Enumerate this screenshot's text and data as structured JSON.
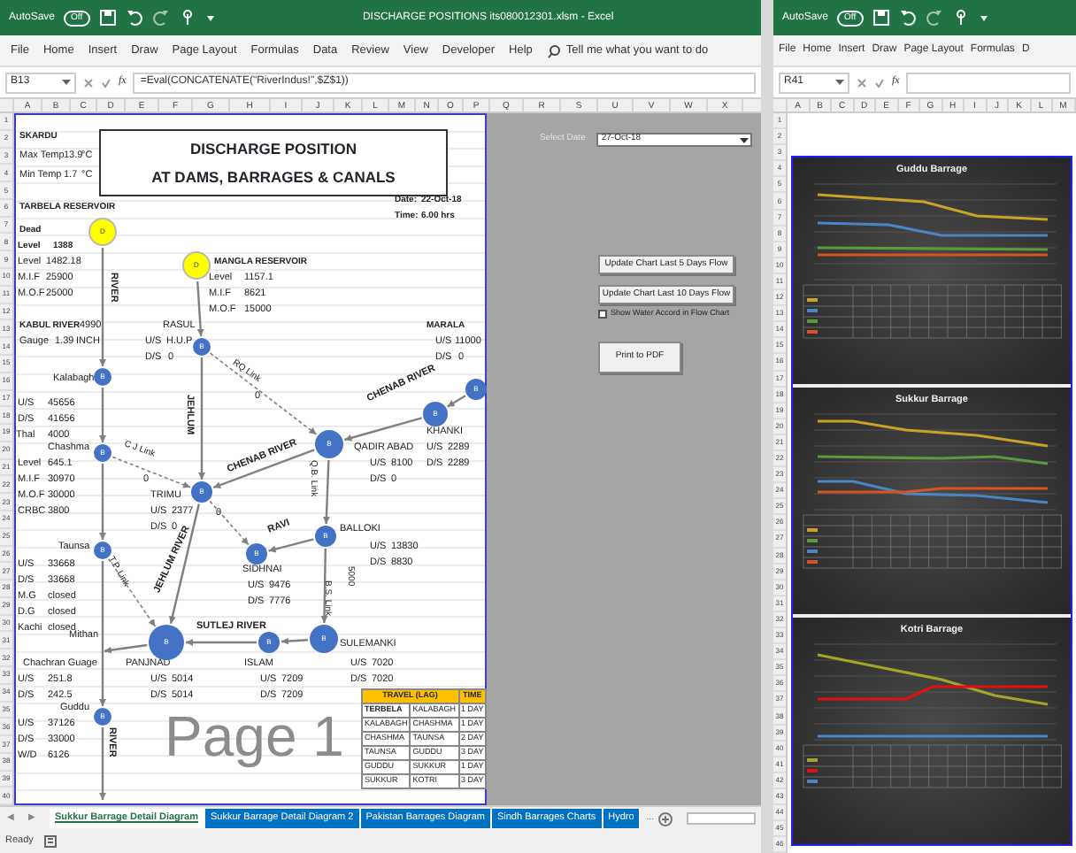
{
  "main_window": {
    "title_bar": {
      "autosave_label": "AutoSave",
      "autosave": {
        "on": false,
        "text": "Off"
      },
      "title": "DISCHARGE POSITIONS its080012301.xlsm - Excel"
    },
    "ribbon_tabs": [
      "File",
      "Home",
      "Insert",
      "Draw",
      "Page Layout",
      "Formulas",
      "Data",
      "Review",
      "View",
      "Developer",
      "Help"
    ],
    "search_hint": "Tell me what you want to do",
    "name_box": "B13",
    "fx": "fx",
    "formula": "=Eval(CONCATENATE(\"RiverIndus!\",$Z$1))",
    "columns": [
      "A",
      "B",
      "C",
      "D",
      "E",
      "F",
      "G",
      "H",
      "I",
      "J",
      "K",
      "L",
      "M",
      "N",
      "O",
      "P",
      "Q",
      "R",
      "S",
      "U",
      "V",
      "W",
      "X"
    ],
    "rows": [
      "1",
      "2",
      "3",
      "4",
      "5",
      "6",
      "7",
      "8",
      "9",
      "10",
      "11",
      "12",
      "13",
      "14",
      "15",
      "16",
      "17",
      "18",
      "19",
      "20",
      "21",
      "22",
      "23",
      "24",
      "25",
      "26",
      "27",
      "28",
      "29",
      "30",
      "31",
      "32",
      "33",
      "34",
      "35",
      "36",
      "37",
      "38",
      "39",
      "40"
    ],
    "report": {
      "title_lines": [
        "DISCHARGE POSITION",
        "AT DAMS, BARRAGES & CANALS"
      ],
      "labels": [
        {
          "text": "SKARDU",
          "kind": "heading"
        },
        {
          "text": "Max Temp",
          "kind": "value"
        },
        {
          "text": "13.9",
          "kind": "value"
        },
        {
          "text": "°C",
          "kind": "value"
        },
        {
          "text": "Min Temp",
          "kind": "value"
        },
        {
          "text": "1.7",
          "kind": "value"
        },
        {
          "text": "°C",
          "kind": "value"
        },
        {
          "text": "Date:",
          "kind": "heading"
        },
        {
          "text": "22-Oct-18",
          "kind": "heading"
        },
        {
          "text": "TARBELA RESERVOIR",
          "kind": "heading"
        },
        {
          "text": "Time:",
          "kind": "heading"
        },
        {
          "text": "6.00 hrs",
          "kind": "heading"
        },
        {
          "text": "Dead",
          "kind": "heading"
        },
        {
          "text": "Level",
          "kind": "heading"
        },
        {
          "text": "1388",
          "kind": "heading"
        },
        {
          "text": "Level",
          "kind": "value"
        },
        {
          "text": "1482.18",
          "kind": "value"
        },
        {
          "text": "M.I.F",
          "kind": "value"
        },
        {
          "text": "25900",
          "kind": "value"
        },
        {
          "text": "M.O.F",
          "kind": "value"
        },
        {
          "text": "25000",
          "kind": "value"
        },
        {
          "text": "MANGLA RESERVOIR",
          "kind": "heading"
        },
        {
          "text": "Level",
          "kind": "value"
        },
        {
          "text": "1157.1",
          "kind": "value"
        },
        {
          "text": "M.I.F",
          "kind": "value"
        },
        {
          "text": "8621",
          "kind": "value"
        },
        {
          "text": "M.O.F",
          "kind": "value"
        },
        {
          "text": "15000",
          "kind": "value"
        },
        {
          "text": "RIVER",
          "kind": "river"
        },
        {
          "text": "KABUL RIVER",
          "kind": "heading"
        },
        {
          "text": "4990",
          "kind": "value"
        },
        {
          "text": "Gauge",
          "kind": "value"
        },
        {
          "text": "1.39",
          "kind": "value"
        },
        {
          "text": "INCH",
          "kind": "value"
        },
        {
          "text": "RASUL",
          "kind": "value"
        },
        {
          "text": "U/S",
          "kind": "value"
        },
        {
          "text": "H.U.P",
          "kind": "value"
        },
        {
          "text": "D/S",
          "kind": "value"
        },
        {
          "text": "0",
          "kind": "value"
        },
        {
          "text": "MARALA",
          "kind": "heading"
        },
        {
          "text": "U/S",
          "kind": "value"
        },
        {
          "text": "11000",
          "kind": "value"
        },
        {
          "text": "D/S",
          "kind": "value"
        },
        {
          "text": "0",
          "kind": "value"
        },
        {
          "text": "Kalabagh",
          "kind": "value"
        },
        {
          "text": "RQ Link",
          "kind": "link"
        },
        {
          "text": "0",
          "kind": "value"
        },
        {
          "text": "U/S",
          "kind": "value"
        },
        {
          "text": "45656",
          "kind": "value"
        },
        {
          "text": "D/S",
          "kind": "value"
        },
        {
          "text": "41656",
          "kind": "value"
        },
        {
          "text": "Thal",
          "kind": "value"
        },
        {
          "text": "4000",
          "kind": "value"
        },
        {
          "text": "CHENAB RIVER",
          "kind": "river"
        },
        {
          "text": "KHANKI",
          "kind": "value"
        },
        {
          "text": "JEHLUM",
          "kind": "river"
        },
        {
          "text": "Chashma",
          "kind": "value"
        },
        {
          "text": "C J Link",
          "kind": "link"
        },
        {
          "text": "QADIR ABAD",
          "kind": "value"
        },
        {
          "text": "U/S",
          "kind": "value"
        },
        {
          "text": "2289",
          "kind": "value"
        },
        {
          "text": "Level",
          "kind": "value"
        },
        {
          "text": "645.1",
          "kind": "value"
        },
        {
          "text": "U/S",
          "kind": "value"
        },
        {
          "text": "8100",
          "kind": "value"
        },
        {
          "text": "D/S",
          "kind": "value"
        },
        {
          "text": "2289",
          "kind": "value"
        },
        {
          "text": "M.I.F",
          "kind": "value"
        },
        {
          "text": "30970",
          "kind": "value"
        },
        {
          "text": "0",
          "kind": "value"
        },
        {
          "text": "D/S",
          "kind": "value"
        },
        {
          "text": "0",
          "kind": "value"
        },
        {
          "text": "M.O.F",
          "kind": "value"
        },
        {
          "text": "30000",
          "kind": "value"
        },
        {
          "text": "TRIMU",
          "kind": "value"
        },
        {
          "text": "CHENAB RIVER",
          "kind": "river"
        },
        {
          "text": "Q.B. Link",
          "kind": "link"
        },
        {
          "text": "CRBC",
          "kind": "value"
        },
        {
          "text": "3800",
          "kind": "value"
        },
        {
          "text": "U/S",
          "kind": "value"
        },
        {
          "text": "2377",
          "kind": "value"
        },
        {
          "text": "0",
          "kind": "value"
        },
        {
          "text": "D/S",
          "kind": "value"
        },
        {
          "text": "0",
          "kind": "value"
        },
        {
          "text": "RAVI",
          "kind": "river"
        },
        {
          "text": "BALLOKI",
          "kind": "value"
        },
        {
          "text": "Taunsa",
          "kind": "value"
        },
        {
          "text": "U/S",
          "kind": "value"
        },
        {
          "text": "13830",
          "kind": "value"
        },
        {
          "text": "D/S",
          "kind": "value"
        },
        {
          "text": "8830",
          "kind": "value"
        },
        {
          "text": "T.P. Link",
          "kind": "link"
        },
        {
          "text": "JEHLUM RIVER",
          "kind": "river"
        },
        {
          "text": "SIDHNAI",
          "kind": "value"
        },
        {
          "text": "U/S",
          "kind": "value"
        },
        {
          "text": "9476",
          "kind": "value"
        },
        {
          "text": "D/S",
          "kind": "value"
        },
        {
          "text": "7776",
          "kind": "value"
        },
        {
          "text": "U/S",
          "kind": "value"
        },
        {
          "text": "33668",
          "kind": "value"
        },
        {
          "text": "D/S",
          "kind": "value"
        },
        {
          "text": "33668",
          "kind": "value"
        },
        {
          "text": "M.G",
          "kind": "value"
        },
        {
          "text": "closed",
          "kind": "value"
        },
        {
          "text": "D.G",
          "kind": "value"
        },
        {
          "text": "closed",
          "kind": "value"
        },
        {
          "text": "Kachi",
          "kind": "value"
        },
        {
          "text": "closed",
          "kind": "value"
        },
        {
          "text": "B.S. Link",
          "kind": "link"
        },
        {
          "text": "5000",
          "kind": "link"
        },
        {
          "text": "SUTLEJ RIVER",
          "kind": "river"
        },
        {
          "text": "Mithan",
          "kind": "value"
        },
        {
          "text": "SULEMANKI",
          "kind": "value"
        },
        {
          "text": "Chachran Guage",
          "kind": "value"
        },
        {
          "text": "PANJNAD",
          "kind": "value"
        },
        {
          "text": "ISLAM",
          "kind": "value"
        },
        {
          "text": "U/S",
          "kind": "value"
        },
        {
          "text": "7020",
          "kind": "value"
        },
        {
          "text": "U/S",
          "kind": "value"
        },
        {
          "text": "251.8",
          "kind": "value"
        },
        {
          "text": "U/S",
          "kind": "value"
        },
        {
          "text": "5014",
          "kind": "value"
        },
        {
          "text": "U/S",
          "kind": "value"
        },
        {
          "text": "7209",
          "kind": "value"
        },
        {
          "text": "D/S",
          "kind": "value"
        },
        {
          "text": "7020",
          "kind": "value"
        },
        {
          "text": "D/S",
          "kind": "value"
        },
        {
          "text": "242.5",
          "kind": "value"
        },
        {
          "text": "D/S",
          "kind": "value"
        },
        {
          "text": "5014",
          "kind": "value"
        },
        {
          "text": "D/S",
          "kind": "value"
        },
        {
          "text": "7209",
          "kind": "value"
        },
        {
          "text": "Guddu",
          "kind": "value"
        },
        {
          "text": "U/S",
          "kind": "value"
        },
        {
          "text": "37126",
          "kind": "value"
        },
        {
          "text": "D/S",
          "kind": "value"
        },
        {
          "text": "33000",
          "kind": "value"
        },
        {
          "text": "W/D",
          "kind": "value"
        },
        {
          "text": "6126",
          "kind": "value"
        },
        {
          "text": "RIVER",
          "kind": "river"
        }
      ],
      "nodes": [
        {
          "kind": "dam",
          "label": "D"
        },
        {
          "kind": "dam",
          "label": "D"
        },
        {
          "kind": "barrage",
          "label": "B"
        },
        {
          "kind": "barrage",
          "label": "B"
        },
        {
          "kind": "barrage",
          "label": "B"
        },
        {
          "kind": "barrage",
          "label": "B"
        },
        {
          "kind": "barrage",
          "label": "B"
        },
        {
          "kind": "barrage",
          "label": "B"
        },
        {
          "kind": "barrage",
          "label": "B"
        },
        {
          "kind": "barrage",
          "label": "B"
        },
        {
          "kind": "barrage",
          "label": "B"
        },
        {
          "kind": "barrage",
          "label": "B"
        },
        {
          "kind": "barrage",
          "label": "B"
        },
        {
          "kind": "barrage",
          "label": "B"
        },
        {
          "kind": "barrage",
          "label": "B"
        },
        {
          "kind": "barrage",
          "label": "B"
        }
      ],
      "page_label": "Page 1",
      "travel_table": {
        "columns": [
          {
            "label": "TRAVEL (LAG)",
            "colspan": 2
          },
          {
            "label": "TIME"
          }
        ],
        "rows": [
          [
            "TERBELA",
            "KALABAGH",
            "1 DAY"
          ],
          [
            "KALABAGH",
            "CHASHMA",
            "1 DAY"
          ],
          [
            "CHASHMA",
            "TAUNSA",
            "2 DAY"
          ],
          [
            "TAUNSA",
            "GUDDU",
            "3 DAY"
          ],
          [
            "GUDDU",
            "SUKKUR",
            "1 DAY"
          ],
          [
            "SUKKUR",
            "KOTRI",
            "3 DAY"
          ]
        ]
      }
    },
    "controls": {
      "date_label": "Select Date",
      "date_value": "27-Oct-18",
      "buttons": [
        "Update Chart Last 5 Days Flow",
        "Update Chart Last 10 Days Flow"
      ],
      "checkbox": {
        "label": "Show Water Accord in Flow Chart",
        "checked": false
      },
      "print_button": "Print to PDF"
    },
    "tab_nav": [
      "◀",
      "▶"
    ],
    "sheet_tabs": [
      {
        "label": "Sukkur Barrage Detail Diagram",
        "selected": true
      },
      {
        "label": "Sukkur Barrage Detail Diagram 2",
        "selected": false
      },
      {
        "label": "Pakistan Barrages Diagram",
        "selected": false
      },
      {
        "label": "Sindh Barrages Charts",
        "selected": false
      },
      {
        "label": "Hydro",
        "selected": false
      }
    ],
    "more_tabs": "...",
    "status": "Ready"
  },
  "second_window": {
    "title_bar": {
      "autosave_label": "AutoSave",
      "autosave": {
        "on": false,
        "text": "Off"
      }
    },
    "ribbon_tabs": [
      "File",
      "Home",
      "Insert",
      "Draw",
      "Page Layout",
      "Formulas",
      "D"
    ],
    "name_box": "R41",
    "fx": "fx",
    "columns": [
      "A",
      "B",
      "C",
      "D",
      "E",
      "F",
      "G",
      "H",
      "I",
      "J",
      "K",
      "L",
      "M"
    ],
    "rows": [
      "1",
      "2",
      "3",
      "4",
      "5",
      "6",
      "7",
      "8",
      "9",
      "10",
      "11",
      "12",
      "13",
      "14",
      "15",
      "16",
      "17",
      "18",
      "19",
      "20",
      "21",
      "22",
      "23",
      "24",
      "25",
      "26",
      "27",
      "28",
      "29",
      "30",
      "31",
      "32",
      "33",
      "34",
      "35",
      "36",
      "37",
      "38",
      "39",
      "40",
      "41",
      "42",
      "43",
      "44",
      "45",
      "46"
    ],
    "charts": [
      {
        "title": "Guddu Barrage"
      },
      {
        "title": "Sukkur Barrage"
      },
      {
        "title": "Kotri Barrage"
      }
    ]
  }
}
